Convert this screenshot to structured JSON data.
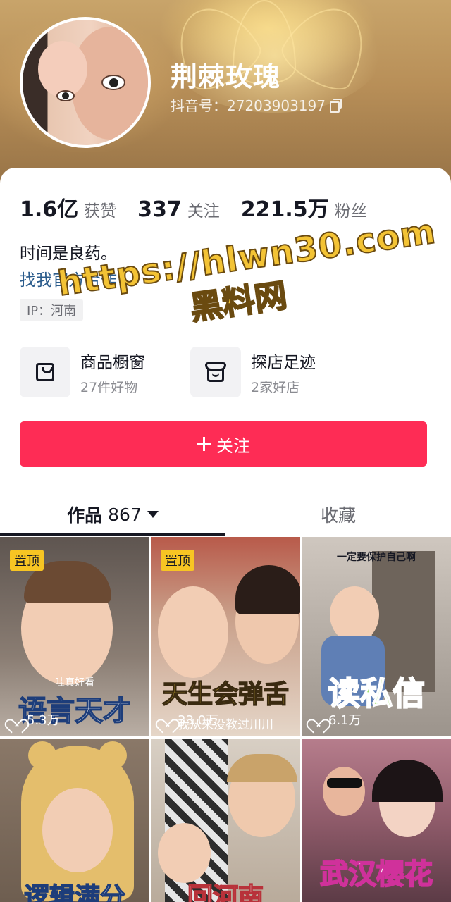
{
  "profile": {
    "username": "荆棘玫瑰",
    "douyin_id": "抖音号：27203903197",
    "bio": "时间是良药。",
    "collab_link": "找我官方合作",
    "ip_label": "IP：河南"
  },
  "stats": [
    {
      "value": "1.6亿",
      "label": "获赞"
    },
    {
      "value": "337",
      "label": "关注"
    },
    {
      "value": "221.5万",
      "label": "粉丝"
    }
  ],
  "watermark": {
    "line1": "https://hlwn30.com",
    "line2": "黑料网"
  },
  "shop": {
    "window": {
      "title": "商品橱窗",
      "subtitle": "27件好物"
    },
    "stores": {
      "title": "探店足迹",
      "subtitle": "2家好店"
    }
  },
  "follow_button": "关注",
  "tabs": {
    "works_label": "作品",
    "works_count": "867",
    "favorites_label": "收藏"
  },
  "videos": [
    {
      "pinned": "置顶",
      "likes": "5.3万",
      "title": "语言天才",
      "caption": "哇真好看"
    },
    {
      "pinned": "置顶",
      "likes": "33.0万",
      "title": "天生会弹舌",
      "caption": "我从来没教过川川"
    },
    {
      "pinned": "",
      "likes": "6.1万",
      "title": "读私信",
      "caption": "一定要保护自己啊"
    },
    {
      "pinned": "",
      "likes": "",
      "title": "逻辑满分",
      "caption": ""
    },
    {
      "pinned": "",
      "likes": "",
      "title": "回河南",
      "caption": ""
    },
    {
      "pinned": "",
      "likes": "",
      "title": "武汉樱花",
      "caption": ""
    }
  ],
  "colors": {
    "accent": "#fe2c55",
    "link": "#2b5c8c",
    "pin_badge": "#f7c523",
    "watermark": "#f3c335"
  }
}
